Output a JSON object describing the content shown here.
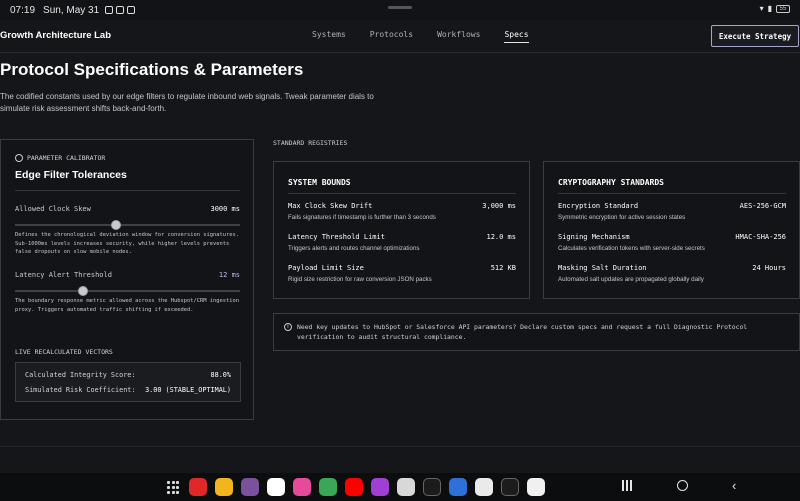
{
  "status_bar": {
    "time": "07:19",
    "date": "Sun, May 31",
    "battery": "55"
  },
  "header": {
    "brand": "Growth Architecture Lab",
    "nav": [
      {
        "label": "Systems",
        "active": false
      },
      {
        "label": "Protocols",
        "active": false
      },
      {
        "label": "Workflows",
        "active": false
      },
      {
        "label": "Specs",
        "active": true
      }
    ],
    "cta": "Execute Strategy"
  },
  "hero": {
    "title": "Protocol Specifications & Parameters",
    "description": "The codified constants used by our edge filters to regulate inbound web signals. Tweak parameter dials to simulate risk assessment shifts back-and-forth."
  },
  "calibrator": {
    "kicker": "PARAMETER CALIBRATOR",
    "title": "Edge Filter Tolerances",
    "params": [
      {
        "label": "Allowed Clock Skew",
        "value": "3000 ms",
        "level": 0.45,
        "description": "Defines the chronological deviation window for conversion signatures. Sub-1000ms levels increases security, while higher levels prevents false dropouts on slow mobile nodes."
      },
      {
        "label": "Latency Alert Threshold",
        "value": "12 ms",
        "level": 0.3,
        "description": "The boundary response metric allowed across the Hubspot/CRM ingestion proxy. Triggers automated traffic shifting if exceeded."
      }
    ],
    "vectors_title": "LIVE RECALCULATED VECTORS",
    "vectors": [
      {
        "label": "Calculated Integrity Score:",
        "value": "88.0%"
      },
      {
        "label": "Simulated Risk Coefficient:",
        "value": "3.00 (STABLE_OPTIMAL)"
      }
    ]
  },
  "registries": {
    "label": "STANDARD REGISTRIES",
    "system_bounds": {
      "title": "SYSTEM BOUNDS",
      "items": [
        {
          "name": "Max Clock Skew Drift",
          "value": "3,000 ms",
          "desc": "Fails signatures if timestamp is further than 3 seconds"
        },
        {
          "name": "Latency Threshold Limit",
          "value": "12.0 ms",
          "desc": "Triggers alerts and routes channel optimizations"
        },
        {
          "name": "Payload Limit Size",
          "value": "512 KB",
          "desc": "Rigid size restriction for raw conversion JSON packs"
        }
      ]
    },
    "crypto": {
      "title": "CRYPTOGRAPHY STANDARDS",
      "items": [
        {
          "name": "Encryption Standard",
          "value": "AES-256-GCM",
          "desc": "Symmetric encryption for active session states"
        },
        {
          "name": "Signing Mechanism",
          "value": "HMAC-SHA-256",
          "desc": "Calculates verification tokens with server-side secrets"
        },
        {
          "name": "Masking Salt Duration",
          "value": "24 Hours",
          "desc": "Automated salt updates are propagated globally daily"
        }
      ]
    },
    "notice": "Need key updates to HubSpot or Salesforce API parameters? Declare custom specs and request a full Diagnostic Protocol verification to audit structural compliance."
  },
  "dock": {
    "apps": [
      {
        "icon": "flipboard-icon",
        "color": "#e12828"
      },
      {
        "icon": "notes-icon",
        "color": "#f2b51d"
      },
      {
        "icon": "viber-icon",
        "color": "#7b519d"
      },
      {
        "icon": "gmail-icon",
        "color": "#ffffff"
      },
      {
        "icon": "blossom-icon",
        "color": "#e64a9a"
      },
      {
        "icon": "chrome-icon",
        "color": "#3aa757"
      },
      {
        "icon": "youtube-icon",
        "color": "#ff0000"
      },
      {
        "icon": "app-grid-icon",
        "color": "#a03fd6"
      },
      {
        "icon": "camera-icon",
        "color": "#d8d8d8"
      },
      {
        "icon": "edit-square-icon",
        "color": "#1c1c1c"
      },
      {
        "icon": "gamepad-icon",
        "color": "#2f6fd8"
      },
      {
        "icon": "signal-icon",
        "color": "#eaeaea"
      },
      {
        "icon": "sparkle-icon",
        "color": "#1c1c1c"
      },
      {
        "icon": "compass-icon",
        "color": "#f0f0f0"
      }
    ]
  }
}
